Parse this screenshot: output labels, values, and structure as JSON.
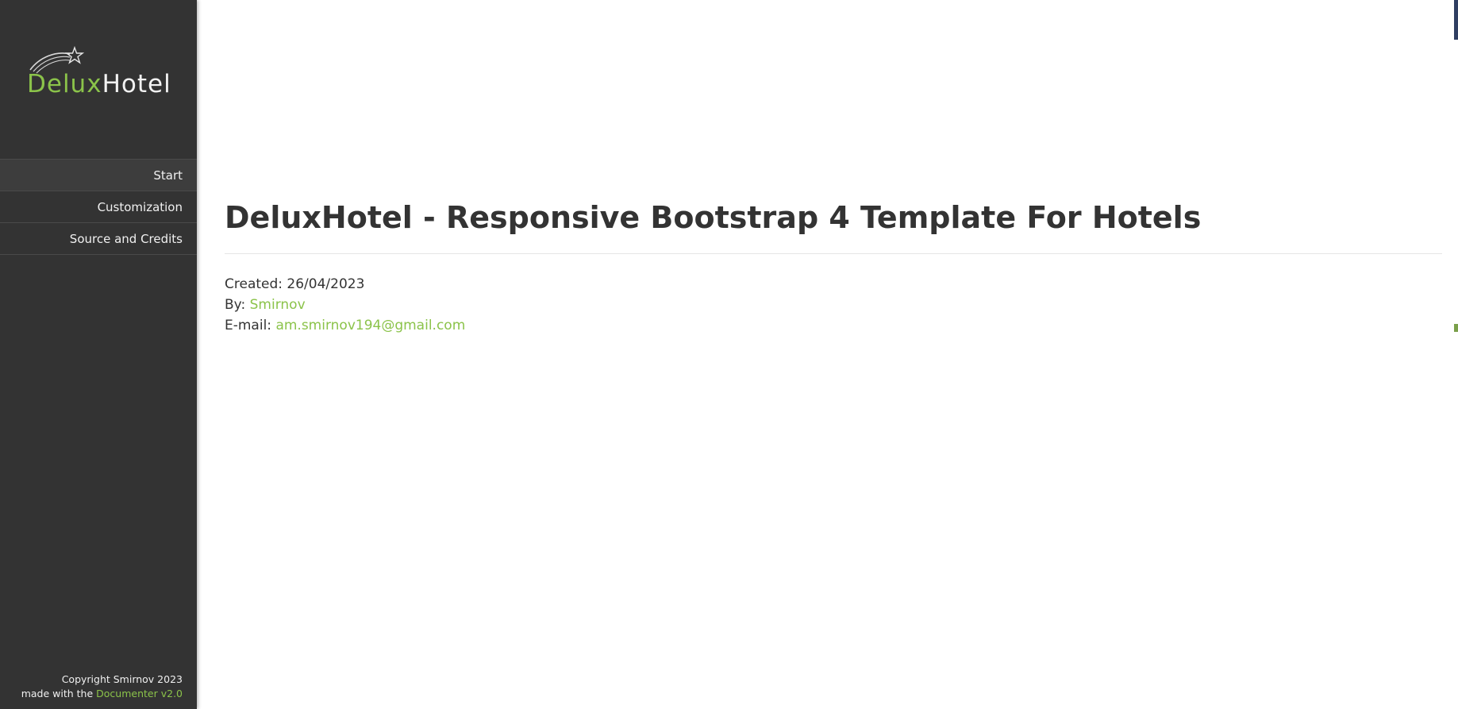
{
  "sidebar": {
    "logo": {
      "word_a": "Delux",
      "word_b": "Hotel",
      "icon": "shooting-star-icon"
    },
    "nav": [
      {
        "label": "Start",
        "active": true
      },
      {
        "label": "Customization",
        "active": false
      },
      {
        "label": "Source and Credits",
        "active": false
      }
    ],
    "footer": {
      "copyright": "Copyright Smirnov 2023",
      "made_with": "made with the",
      "tool_link": "Documenter v2.0"
    }
  },
  "main": {
    "title": "DeluxHotel - Responsive Bootstrap 4 Template For Hotels",
    "created_label": "Created:",
    "created_value": "26/04/2023",
    "by_label": "By:",
    "by_value": "Smirnov",
    "email_label": "E-mail:",
    "email_value": "am.smirnov194@gmail.com"
  },
  "colors": {
    "accent": "#8bc34a",
    "sidebar_bg": "#333333",
    "text": "#333333"
  }
}
